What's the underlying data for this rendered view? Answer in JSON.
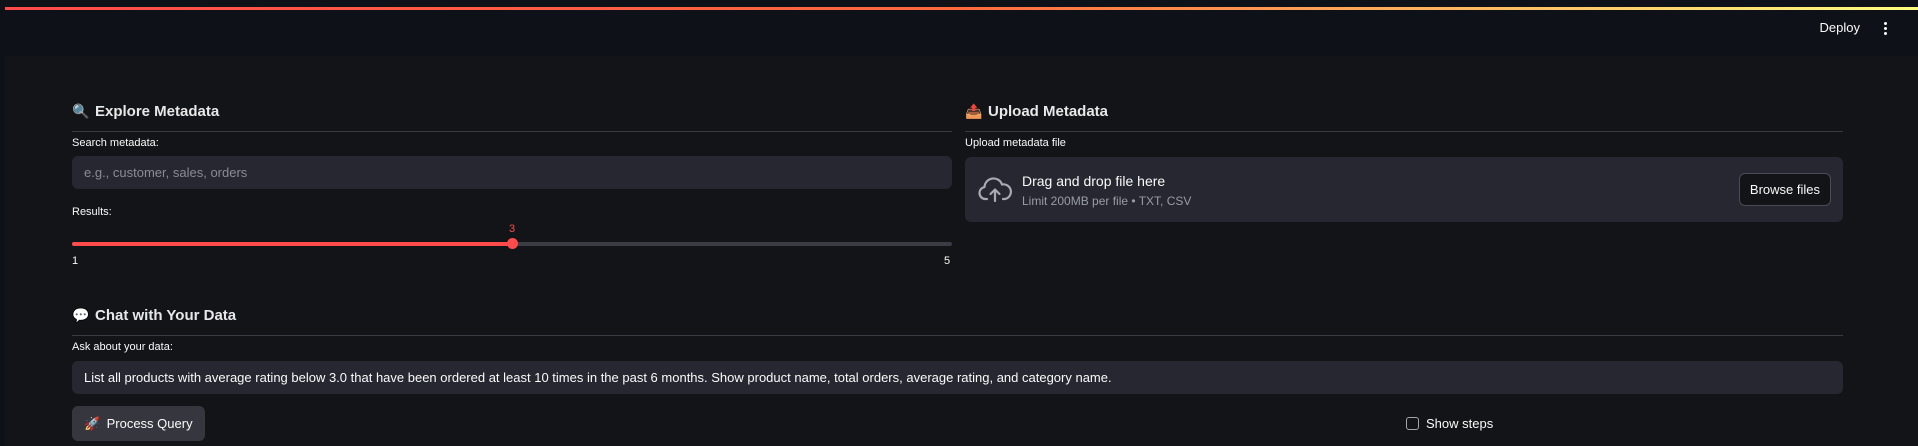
{
  "header": {
    "deploy_label": "Deploy",
    "menu_icon": "kebab-menu-icon"
  },
  "explore": {
    "icon": "🔍",
    "title": "Explore Metadata",
    "search_label": "Search metadata:",
    "search_placeholder": "e.g., customer, sales, orders",
    "search_value": "",
    "results_label": "Results:",
    "slider": {
      "min": 1,
      "max": 5,
      "value": 3,
      "min_label": "1",
      "max_label": "5",
      "value_label": "3"
    }
  },
  "upload": {
    "icon": "📤",
    "title": "Upload Metadata",
    "file_label": "Upload metadata file",
    "drop_title": "Drag and drop file here",
    "drop_subtitle": "Limit 200MB per file • TXT, CSV",
    "browse_label": "Browse files",
    "cloud_icon": "cloud-upload-icon"
  },
  "chat": {
    "icon": "💬",
    "title": "Chat with Your Data",
    "ask_label": "Ask about your data:",
    "query_value": "List all products with average rating below 3.0 that have been ordered at least 10 times in the past 6 months. Show product name, total orders, average rating, and category name.",
    "process_icon": "🚀",
    "process_label": "Process Query",
    "show_steps_label": "Show steps",
    "show_steps_checked": false
  },
  "colors": {
    "accent": "#ff4b4b",
    "background": "#131417",
    "input_bg": "#262730"
  }
}
